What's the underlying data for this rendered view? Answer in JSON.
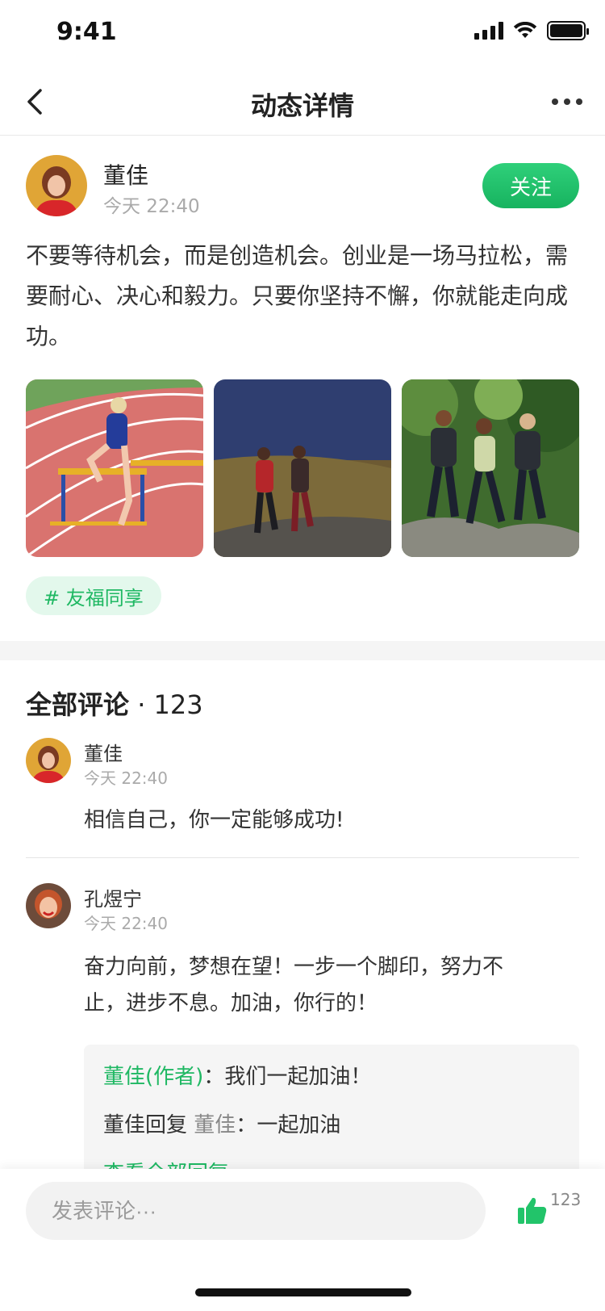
{
  "status": {
    "time": "9:41"
  },
  "nav": {
    "title": "动态详情"
  },
  "post": {
    "author": "董佳",
    "time": "今天 22:40",
    "follow_label": "关注",
    "content": "不要等待机会，而是创造机会。创业是一场马拉松，需要耐心、决心和毅力。只要你坚持不懈，你就能走向成功。",
    "tag": "# 友福同享"
  },
  "comments": {
    "title": "全部评论",
    "count": "· 123",
    "items": [
      {
        "name": "董佳",
        "time": "今天 22:40",
        "text": "相信自己，你一定能够成功!"
      },
      {
        "name": "孔煜宁",
        "time": "今天 22:40",
        "text": "奋力向前，梦想在望！一步一个脚印，努力不止，进步不息。加油，你行的！"
      }
    ],
    "replies": [
      {
        "author": "董佳(作者)",
        "sep": "：",
        "text": "我们一起加油！"
      },
      {
        "author": "董佳回复",
        "target": "董佳",
        "sep": "：",
        "text": "一起加油"
      }
    ],
    "view_all": "查看全部回复"
  },
  "bottom": {
    "placeholder": "发表评论···",
    "like_count": "123"
  },
  "colors": {
    "accent": "#1fb863",
    "tag_bg": "#e3f8ec"
  }
}
